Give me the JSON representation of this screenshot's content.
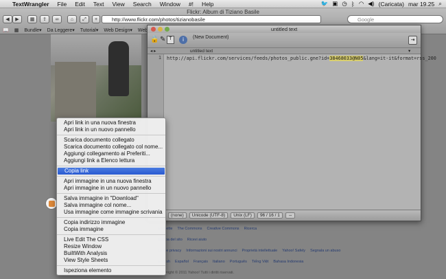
{
  "menubar": {
    "apple": "",
    "app": "TextWrangler",
    "items": [
      "File",
      "Edit",
      "Text",
      "View",
      "Search",
      "Window",
      "#!",
      "Help"
    ],
    "battery": "(Caricata)",
    "clock": "mar 19.25"
  },
  "browser": {
    "title": "Flickr: Album di Tiziano Basile",
    "url": "http://www.flickr.com/photos/tizianobasile",
    "search_placeholder": "Google",
    "bookmarks": [
      "Bundle▾",
      "Da Leggere▾",
      "Tutorial▾",
      "Web Design▾",
      "Web"
    ]
  },
  "textwrangler": {
    "title": "untitled text",
    "doc_label": "(New Document)",
    "tab_label": "untitled text",
    "line_number": "1",
    "code_before": "http://api.flickr.com/services/feeds/photos_public.gne?id=",
    "code_highlight": "38468033@N05",
    "code_after": "&lang=it-it&format=rss_200",
    "status": {
      "syntax": "(none)",
      "encoding": "Unicode (UTF-8)",
      "linebreaks": "Unix (LF)",
      "position": "96 / 16 / 1"
    }
  },
  "page": {
    "footer_row1": [
      "Etichette",
      "The Commons",
      "Creative Commons",
      "Ricerca"
    ],
    "footer_row2": [
      "Mappa del sito",
      "Ricevi aiuto"
    ],
    "footer_row3": [
      "La tue privacy",
      "Informazioni sui nostri annunci",
      "Proprietà intellettuale",
      "Yahoo! Safely",
      "Segnala un abuso"
    ],
    "footer_langs": [
      "English",
      "Español",
      "Français",
      "",
      "Italiano",
      "Português",
      "Tiếng Việt",
      "Bahasa Indonesia"
    ],
    "copyright": "Copyright © 2011 Yahoo! Tutti i diritti riservati."
  },
  "context_menu": {
    "groups": [
      [
        "Apri link in una nuova finestra",
        "Apri link in un nuovo pannello"
      ],
      [
        "Scarica documento collegato",
        "Scarica documento collegato col nome...",
        "Aggiungi collegamento ai Preferiti...",
        "Aggiungi link a Elenco lettura"
      ],
      [
        "Copia link"
      ],
      [
        "Apri immagine in una nuova finestra",
        "Apri immagine in un nuovo pannello"
      ],
      [
        "Salva immagine in \"Download\"",
        "Salva immagine col nome...",
        "Usa immagine come immagine scrivania"
      ],
      [
        "Copia indirizzo immagine",
        "Copia immagine"
      ],
      [
        "Live Edit The CSS",
        "Resize Window",
        "BuiltWith Analysis",
        "View Style Sheets"
      ],
      [
        "Ispeziona elemento"
      ]
    ],
    "selected": "Copia link"
  },
  "colors": {
    "selection": "#2a5ad1",
    "highlight": "#d9cf6e"
  }
}
